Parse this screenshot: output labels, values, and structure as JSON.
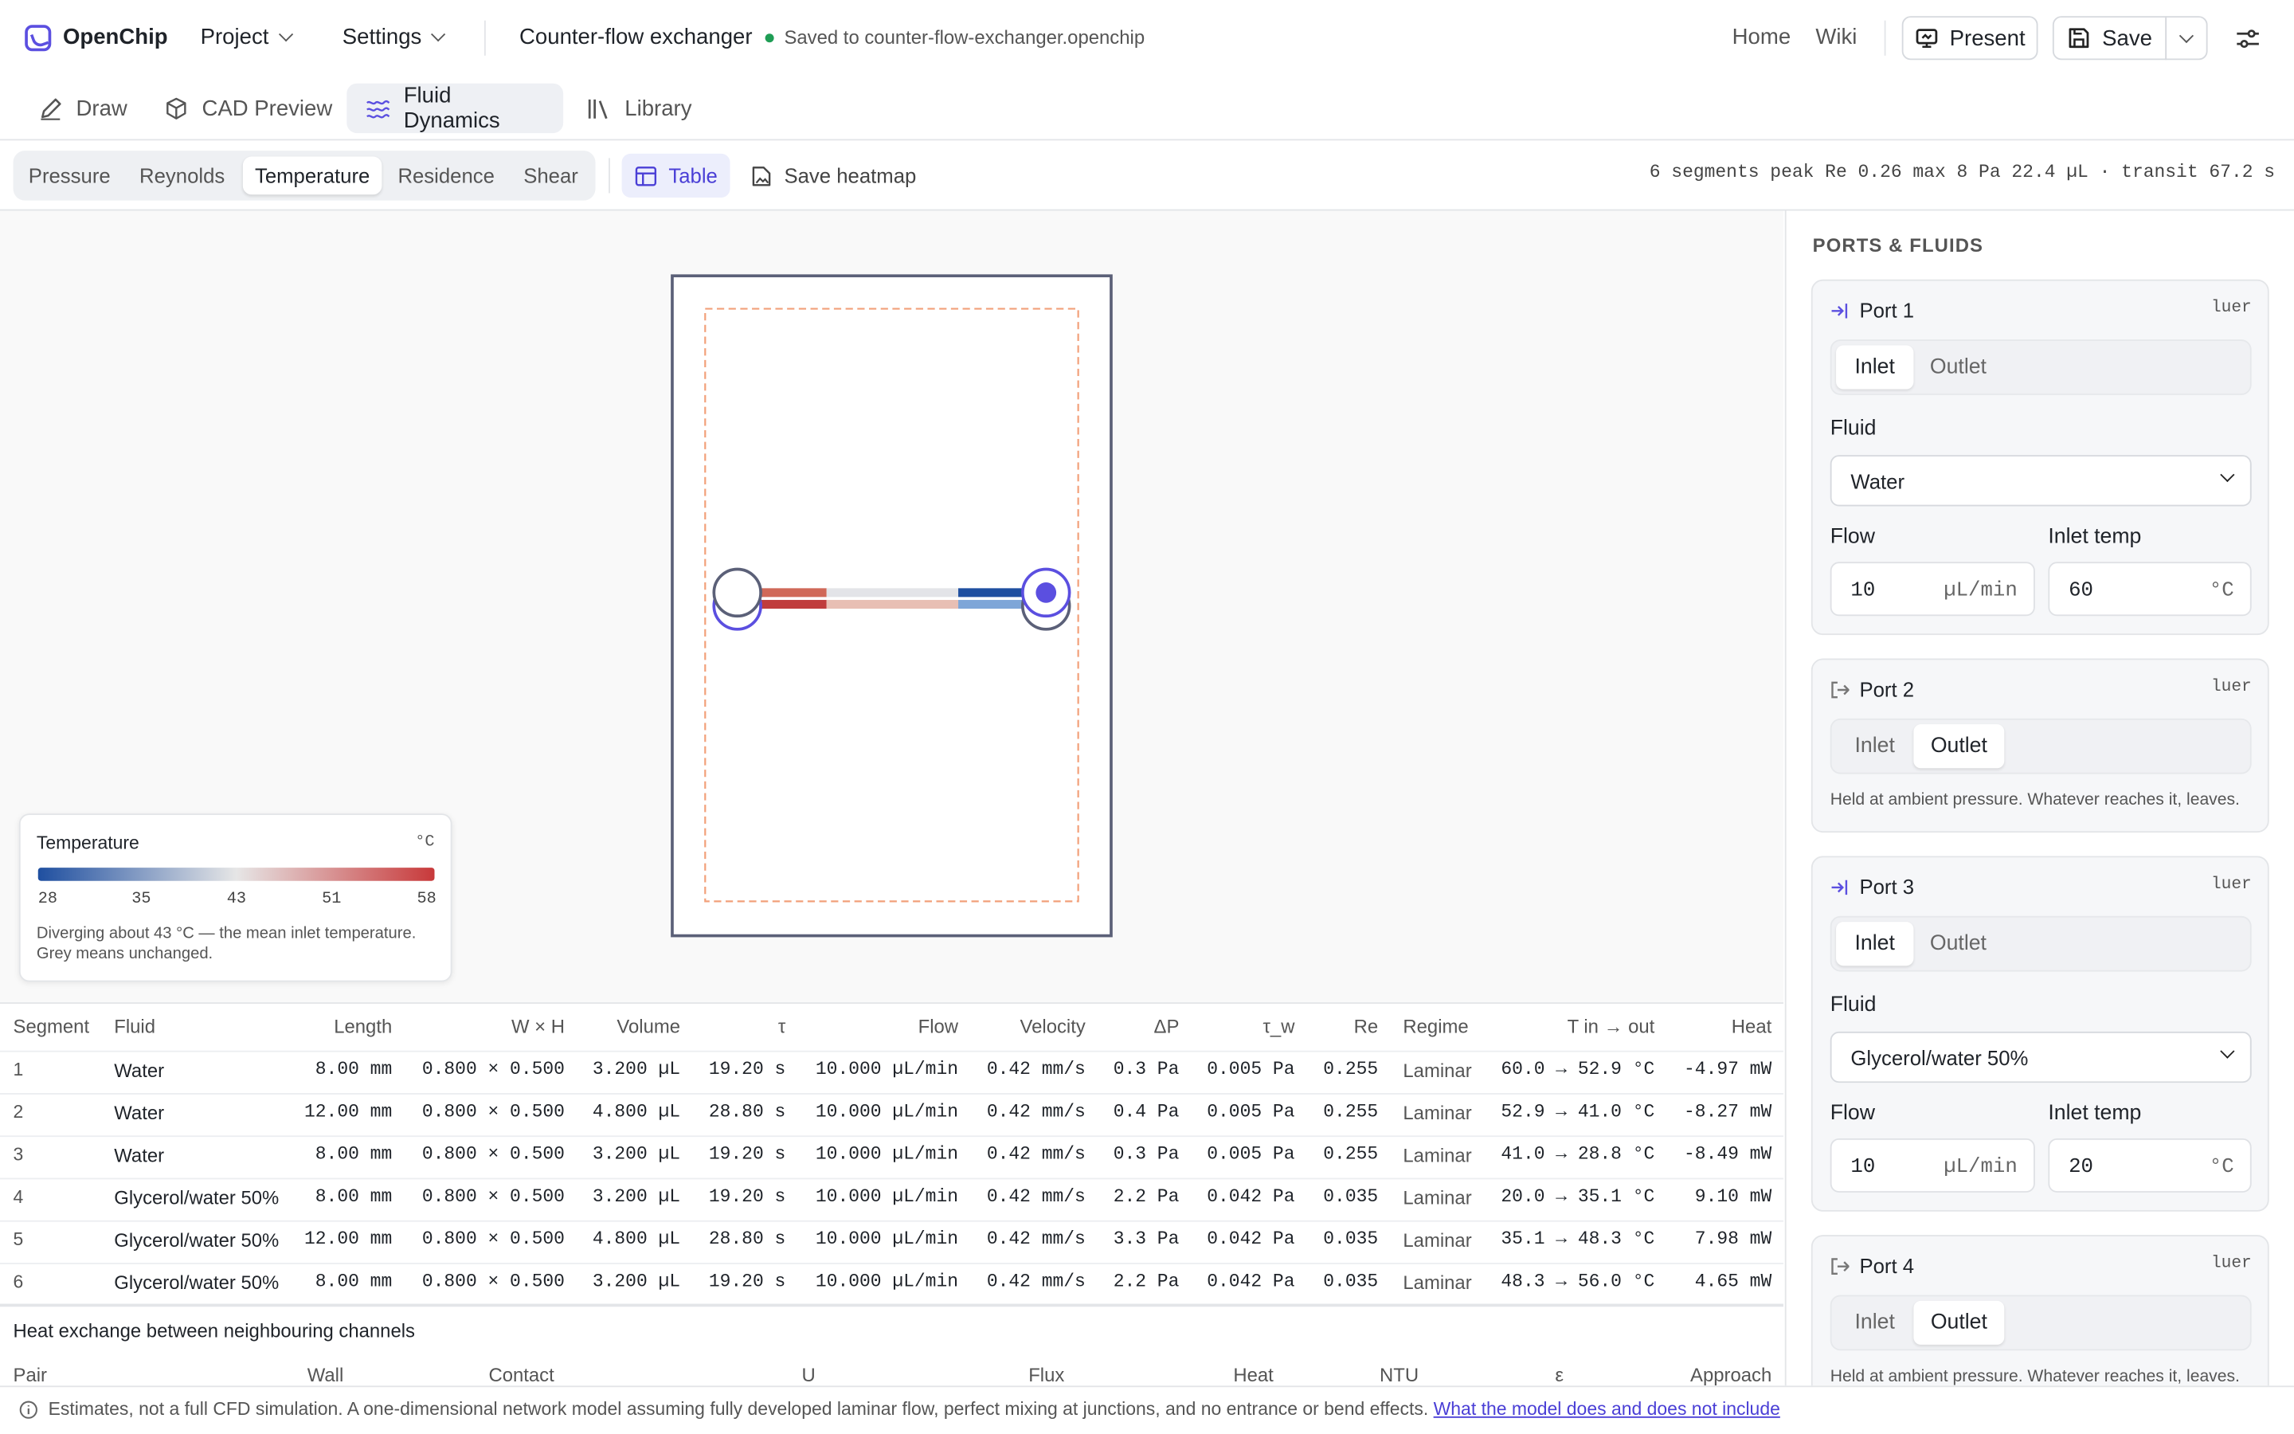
{
  "app": {
    "name": "OpenChip",
    "document": "Counter-flow exchanger",
    "saved_status": "Saved to counter-flow-exchanger.openchip"
  },
  "menus": [
    "Project",
    "Settings"
  ],
  "nav": {
    "home": "Home",
    "wiki": "Wiki",
    "present": "Present",
    "save": "Save"
  },
  "tabs": [
    {
      "label": "Draw",
      "icon": "pencil-icon"
    },
    {
      "label": "CAD Preview",
      "icon": "cube-icon"
    },
    {
      "label": "Fluid Dynamics",
      "icon": "waves-icon",
      "active": true
    },
    {
      "label": "Library",
      "icon": "books-icon"
    }
  ],
  "analysis_modes": [
    {
      "label": "Pressure"
    },
    {
      "label": "Reynolds"
    },
    {
      "label": "Temperature",
      "active": true
    },
    {
      "label": "Residence"
    },
    {
      "label": "Shear"
    }
  ],
  "tools": {
    "table": "Table",
    "save_heatmap": "Save heatmap"
  },
  "stats": "6 segments  peak Re 0.26  max 8 Pa  22.4 µL · transit 67.2 s",
  "legend": {
    "title": "Temperature",
    "unit": "°C",
    "ticks": [
      "28",
      "35",
      "43",
      "51",
      "58"
    ],
    "note_line1": "Diverging about 43 °C — the mean inlet temperature.",
    "note_line2": "Grey means unchanged.",
    "colors": {
      "cold": "#1f4fa0",
      "neutral": "#e6e6e6",
      "hot": "#c8393a"
    }
  },
  "sidebar": {
    "title": "PORTS & FLUIDS",
    "ports": [
      {
        "name": "Port 1",
        "connector": "luer",
        "inlet": "Inlet",
        "outlet": "Outlet",
        "mode": "Inlet",
        "fluid_label": "Fluid",
        "fluid": "Water",
        "flow_label": "Flow",
        "flow": "10",
        "flow_unit": "µL/min",
        "temp_label": "Inlet temp",
        "temp": "60",
        "temp_unit": "°C"
      },
      {
        "name": "Port 2",
        "connector": "luer",
        "inlet": "Inlet",
        "outlet": "Outlet",
        "mode": "Outlet",
        "note": "Held at ambient pressure. Whatever reaches it, leaves."
      },
      {
        "name": "Port 3",
        "connector": "luer",
        "inlet": "Inlet",
        "outlet": "Outlet",
        "mode": "Inlet",
        "fluid_label": "Fluid",
        "fluid": "Glycerol/water 50%",
        "flow_label": "Flow",
        "flow": "10",
        "flow_unit": "µL/min",
        "temp_label": "Inlet temp",
        "temp": "20",
        "temp_unit": "°C"
      },
      {
        "name": "Port 4",
        "connector": "luer",
        "inlet": "Inlet",
        "outlet": "Outlet",
        "mode": "Outlet",
        "note": "Held at ambient pressure. Whatever reaches it, leaves."
      }
    ]
  },
  "segments": {
    "headers": [
      "Segment",
      "Fluid",
      "Length",
      "W × H",
      "Volume",
      "τ",
      "Flow",
      "Velocity",
      "ΔP",
      "τ_w",
      "Re",
      "Regime",
      "T in → out",
      "Heat"
    ],
    "rows": [
      [
        "1",
        "Water",
        "8.00 mm",
        "0.800 × 0.500",
        "3.200 µL",
        "19.20 s",
        "10.000 µL/min",
        "0.42 mm/s",
        "0.3 Pa",
        "0.005 Pa",
        "0.255",
        "Laminar",
        "60.0 → 52.9 °C",
        "-4.97 mW"
      ],
      [
        "2",
        "Water",
        "12.00 mm",
        "0.800 × 0.500",
        "4.800 µL",
        "28.80 s",
        "10.000 µL/min",
        "0.42 mm/s",
        "0.4 Pa",
        "0.005 Pa",
        "0.255",
        "Laminar",
        "52.9 → 41.0 °C",
        "-8.27 mW"
      ],
      [
        "3",
        "Water",
        "8.00 mm",
        "0.800 × 0.500",
        "3.200 µL",
        "19.20 s",
        "10.000 µL/min",
        "0.42 mm/s",
        "0.3 Pa",
        "0.005 Pa",
        "0.255",
        "Laminar",
        "41.0 → 28.8 °C",
        "-8.49 mW"
      ],
      [
        "4",
        "Glycerol/water 50%",
        "8.00 mm",
        "0.800 × 0.500",
        "3.200 µL",
        "19.20 s",
        "10.000 µL/min",
        "0.42 mm/s",
        "2.2 Pa",
        "0.042 Pa",
        "0.035",
        "Laminar",
        "20.0 → 35.1 °C",
        "9.10 mW"
      ],
      [
        "5",
        "Glycerol/water 50%",
        "12.00 mm",
        "0.800 × 0.500",
        "4.800 µL",
        "28.80 s",
        "10.000 µL/min",
        "0.42 mm/s",
        "3.3 Pa",
        "0.042 Pa",
        "0.035",
        "Laminar",
        "35.1 → 48.3 °C",
        "7.98 mW"
      ],
      [
        "6",
        "Glycerol/water 50%",
        "8.00 mm",
        "0.800 × 0.500",
        "3.200 µL",
        "19.20 s",
        "10.000 µL/min",
        "0.42 mm/s",
        "2.2 Pa",
        "0.042 Pa",
        "0.035",
        "Laminar",
        "48.3 → 56.0 °C",
        "4.65 mW"
      ]
    ]
  },
  "heat_exchange": {
    "title": "Heat exchange between neighbouring channels",
    "headers": [
      "Pair",
      "Wall",
      "Contact",
      "U",
      "Flux",
      "Heat",
      "NTU",
      "ε",
      "Approach"
    ]
  },
  "footer": {
    "text": "Estimates, not a full CFD simulation. A one-dimensional network model assuming fully developed laminar flow, perfect mixing at junctions, and no entrance or bend effects.",
    "link": "What the model does and does not include"
  }
}
